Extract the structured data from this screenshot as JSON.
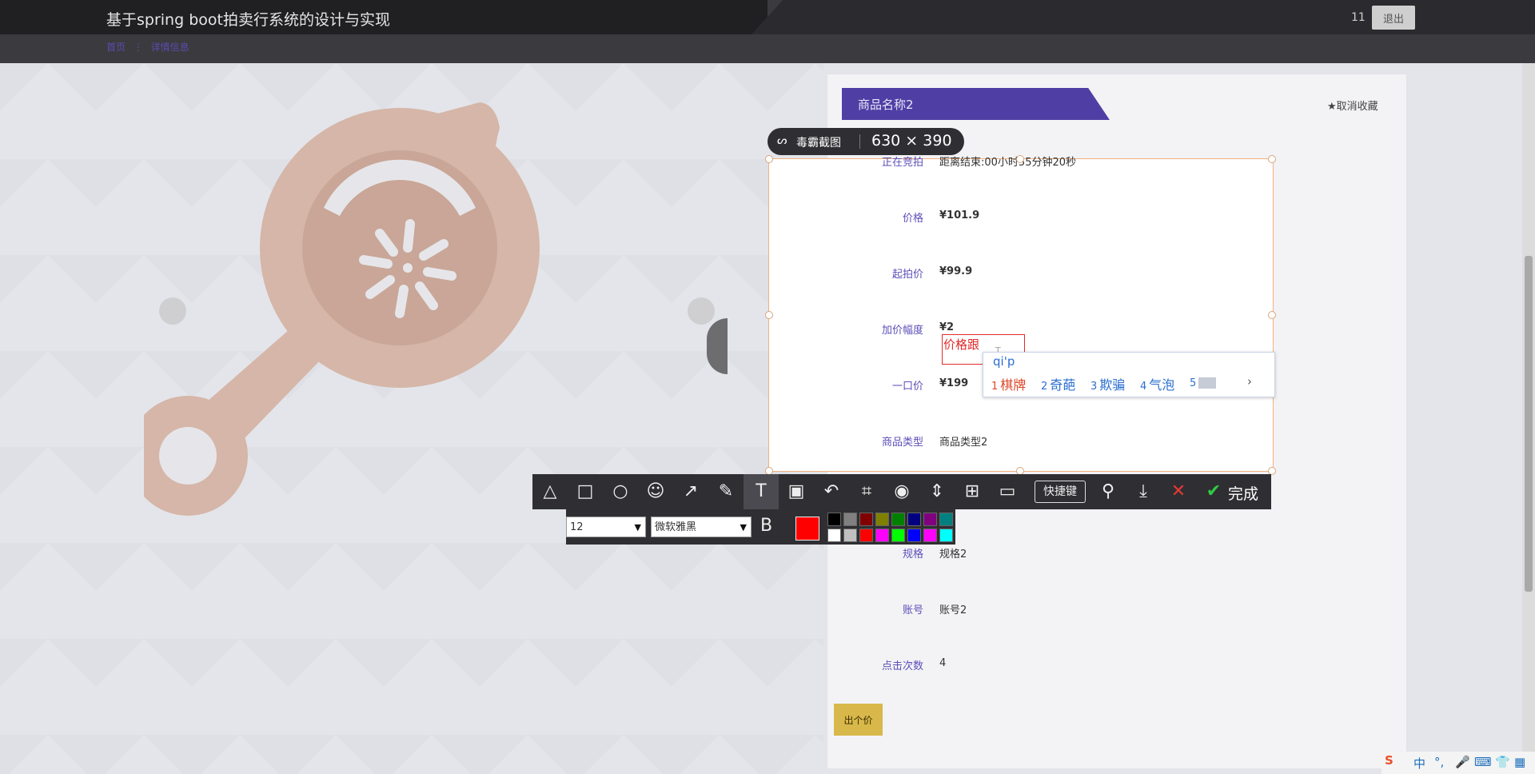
{
  "header": {
    "site_title": "基于spring boot拍卖行系统的设计与实现",
    "breadcrumb": [
      "首页",
      "详情信息"
    ],
    "user": "11",
    "logout_label": "退出"
  },
  "product": {
    "name": "商品名称2",
    "favorite_label": "★取消收藏",
    "bid_button": "出个价"
  },
  "details": [
    {
      "label": "正在竞拍",
      "value": "距离结束:00小时55分钟20秒"
    },
    {
      "label": "价格",
      "value": "¥101.9"
    },
    {
      "label": "起拍价",
      "value": "¥99.9"
    },
    {
      "label": "加价幅度",
      "value": "¥2"
    },
    {
      "label": "一口价",
      "value": "¥199"
    },
    {
      "label": "商品类型",
      "value": "商品类型2"
    },
    {
      "label": "规格",
      "value": "规格2"
    },
    {
      "label": "账号",
      "value": "账号2"
    },
    {
      "label": "点击次数",
      "value": "4"
    }
  ],
  "capture": {
    "app_name": "毒霸截图",
    "size": "630 × 390",
    "text_annotation": "价格跟"
  },
  "ime": {
    "input": "qi'p",
    "candidates": [
      "1",
      "棋牌",
      "2",
      "奇葩",
      "3",
      "欺骗",
      "4",
      "气泡",
      "5"
    ],
    "more": "›"
  },
  "toolbar": {
    "shortcut_label": "快捷键",
    "done_label": "完成",
    "tools": [
      "shapes-icon",
      "rectangle-icon",
      "ellipse-icon",
      "emoji-icon",
      "arrow-icon",
      "pen-icon",
      "text-icon",
      "mosaic-icon",
      "undo-icon",
      "ocr-icon",
      "record-icon",
      "scroll-capture-icon",
      "add-icon",
      "comment-icon"
    ]
  },
  "subbar": {
    "font_size": "12",
    "font_name": "微软雅黑",
    "bold_label": "B",
    "current_color": "#ff0000",
    "swatches_top": [
      "#000000",
      "#808080",
      "#800000",
      "#808000",
      "#008000",
      "#000080",
      "#800080",
      "#008080"
    ],
    "swatches_bottom": [
      "#ffffff",
      "#c0c0c0",
      "#ff0000",
      "#ff00ff",
      "#00ff00",
      "#0000ff",
      "#ff00ff",
      "#00ffff"
    ]
  },
  "tray": {
    "ime_lang": "中"
  }
}
